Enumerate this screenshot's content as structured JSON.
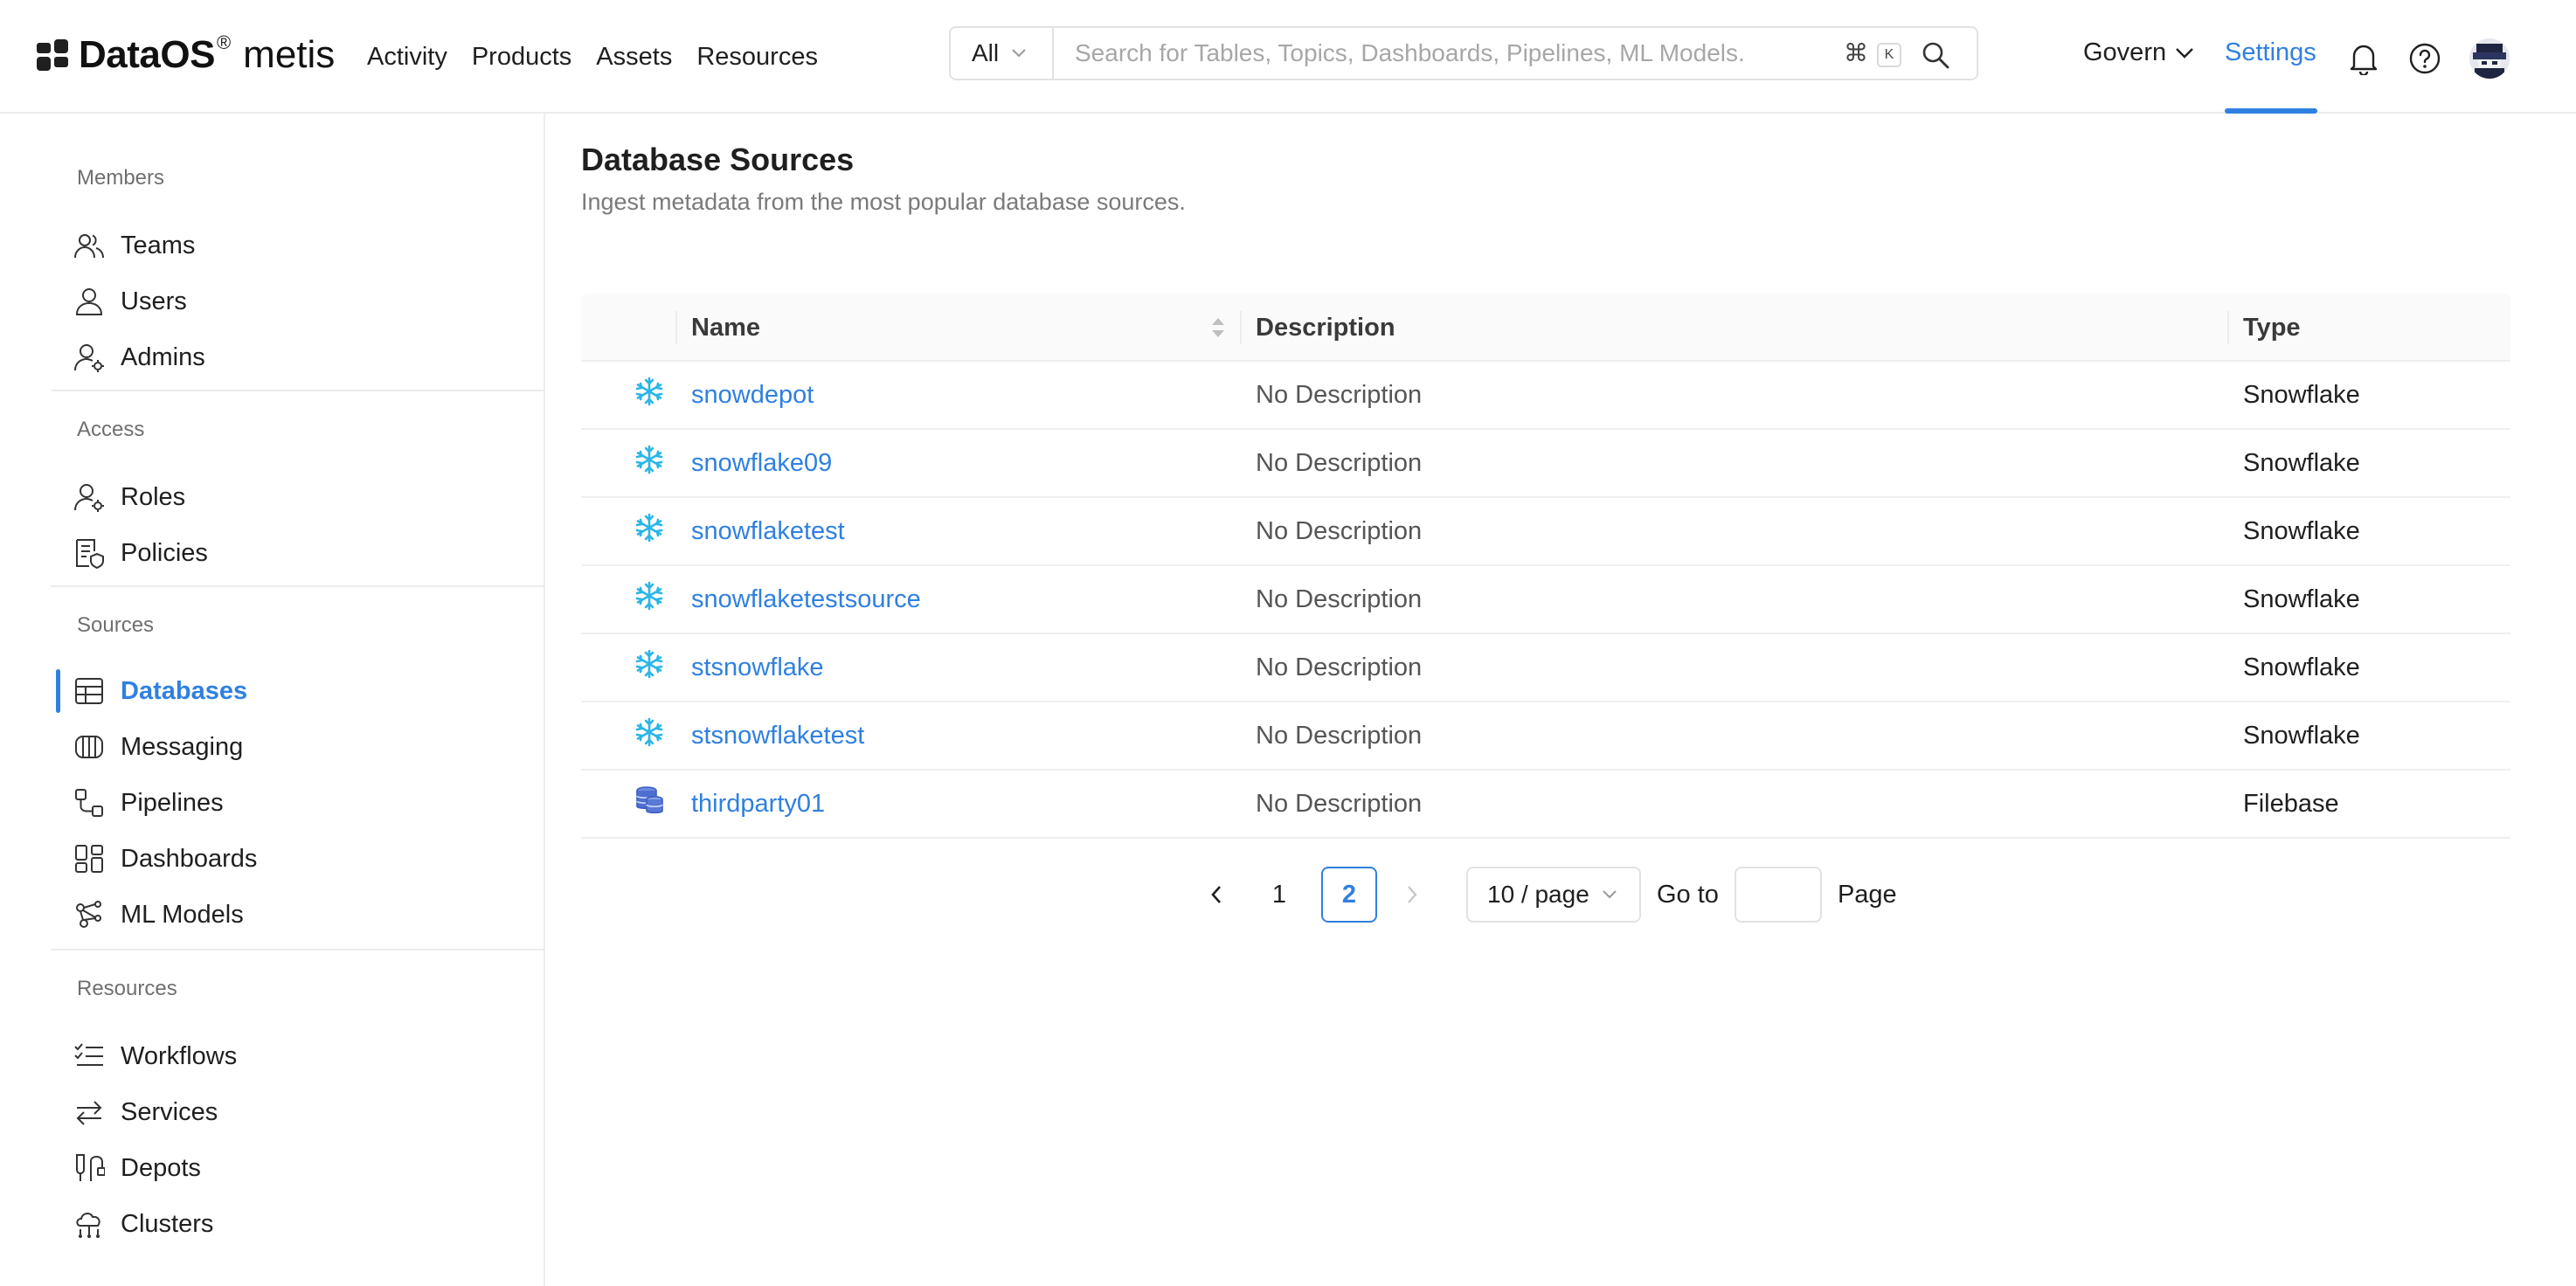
{
  "brand": {
    "name": "DataOS",
    "reg": "®",
    "product": "metis"
  },
  "topnav": [
    "Activity",
    "Products",
    "Assets",
    "Resources"
  ],
  "search": {
    "filter": "All",
    "placeholder": "Search for Tables, Topics, Dashboards, Pipelines, ML Models.",
    "shortcut_cmd": "⌘",
    "shortcut_key": "K"
  },
  "header": {
    "govern": "Govern",
    "settings": "Settings"
  },
  "colors": {
    "accent": "#2f80e0",
    "snowflake": "#29b5e8",
    "filebase": "#3b5fbf"
  },
  "sidebar": {
    "sections": [
      {
        "title": "Members",
        "items": [
          {
            "label": "Teams",
            "icon": "teams-icon"
          },
          {
            "label": "Users",
            "icon": "user-icon"
          },
          {
            "label": "Admins",
            "icon": "admin-icon"
          }
        ]
      },
      {
        "title": "Access",
        "items": [
          {
            "label": "Roles",
            "icon": "roles-icon"
          },
          {
            "label": "Policies",
            "icon": "policies-icon"
          }
        ]
      },
      {
        "title": "Sources",
        "items": [
          {
            "label": "Databases",
            "icon": "database-icon",
            "active": true
          },
          {
            "label": "Messaging",
            "icon": "messaging-icon"
          },
          {
            "label": "Pipelines",
            "icon": "pipelines-icon"
          },
          {
            "label": "Dashboards",
            "icon": "dashboards-icon"
          },
          {
            "label": "ML Models",
            "icon": "ml-models-icon"
          }
        ]
      },
      {
        "title": "Resources",
        "items": [
          {
            "label": "Workflows",
            "icon": "workflows-icon"
          },
          {
            "label": "Services",
            "icon": "services-icon"
          },
          {
            "label": "Depots",
            "icon": "depots-icon"
          },
          {
            "label": "Clusters",
            "icon": "clusters-icon"
          }
        ]
      }
    ]
  },
  "main": {
    "title": "Database Sources",
    "subtitle": "Ingest metadata from the most popular database sources."
  },
  "table": {
    "columns": [
      "Name",
      "Description",
      "Type"
    ],
    "rows": [
      {
        "icon": "snowflake-icon",
        "name": "snowdepot",
        "description": "No Description",
        "type": "Snowflake"
      },
      {
        "icon": "snowflake-icon",
        "name": "snowflake09",
        "description": "No Description",
        "type": "Snowflake"
      },
      {
        "icon": "snowflake-icon",
        "name": "snowflaketest",
        "description": "No Description",
        "type": "Snowflake"
      },
      {
        "icon": "snowflake-icon",
        "name": "snowflaketestsource",
        "description": "No Description",
        "type": "Snowflake"
      },
      {
        "icon": "snowflake-icon",
        "name": "stsnowflake",
        "description": "No Description",
        "type": "Snowflake"
      },
      {
        "icon": "snowflake-icon",
        "name": "stsnowflaketest",
        "description": "No Description",
        "type": "Snowflake"
      },
      {
        "icon": "filebase-icon",
        "name": "thirdparty01",
        "description": "No Description",
        "type": "Filebase"
      }
    ]
  },
  "pagination": {
    "pages": [
      "1",
      "2"
    ],
    "current": "2",
    "page_size": "10 / page",
    "goto_label": "Go to",
    "goto_value": "",
    "page_label": "Page"
  }
}
